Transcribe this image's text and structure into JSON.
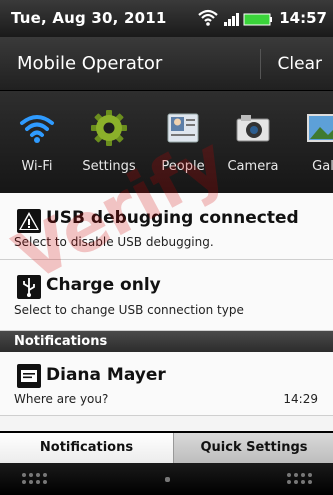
{
  "status_bar": {
    "date": "Tue, Aug 30, 2011",
    "time": "14:57",
    "icons": [
      "wifi-icon",
      "signal-icon",
      "battery-icon"
    ]
  },
  "header": {
    "operator": "Mobile Operator",
    "clear_label": "Clear"
  },
  "quick_settings": [
    {
      "label": "Wi-Fi",
      "icon": "wifi-icon"
    },
    {
      "label": "Settings",
      "icon": "gear-icon"
    },
    {
      "label": "People",
      "icon": "contacts-icon"
    },
    {
      "label": "Camera",
      "icon": "camera-icon"
    },
    {
      "label": "Gal",
      "icon": "gallery-icon"
    }
  ],
  "usb_debug": {
    "title": "USB debugging connected",
    "subtitle": "Select to disable USB debugging."
  },
  "charge": {
    "title": "Charge only",
    "subtitle": "Select to change USB connection type"
  },
  "notifications": {
    "section_label": "Notifications",
    "items": [
      {
        "sender": "Diana Mayer",
        "message": "Where are you?",
        "time": "14:29"
      }
    ]
  },
  "tabs": {
    "notifications": "Notifications",
    "quick_settings": "Quick Settings"
  },
  "watermark": "Verify",
  "colors": {
    "wifi_blue": "#2f9bff",
    "gear_green": "#6b8e1e",
    "panel_bg": "#fafafa"
  }
}
